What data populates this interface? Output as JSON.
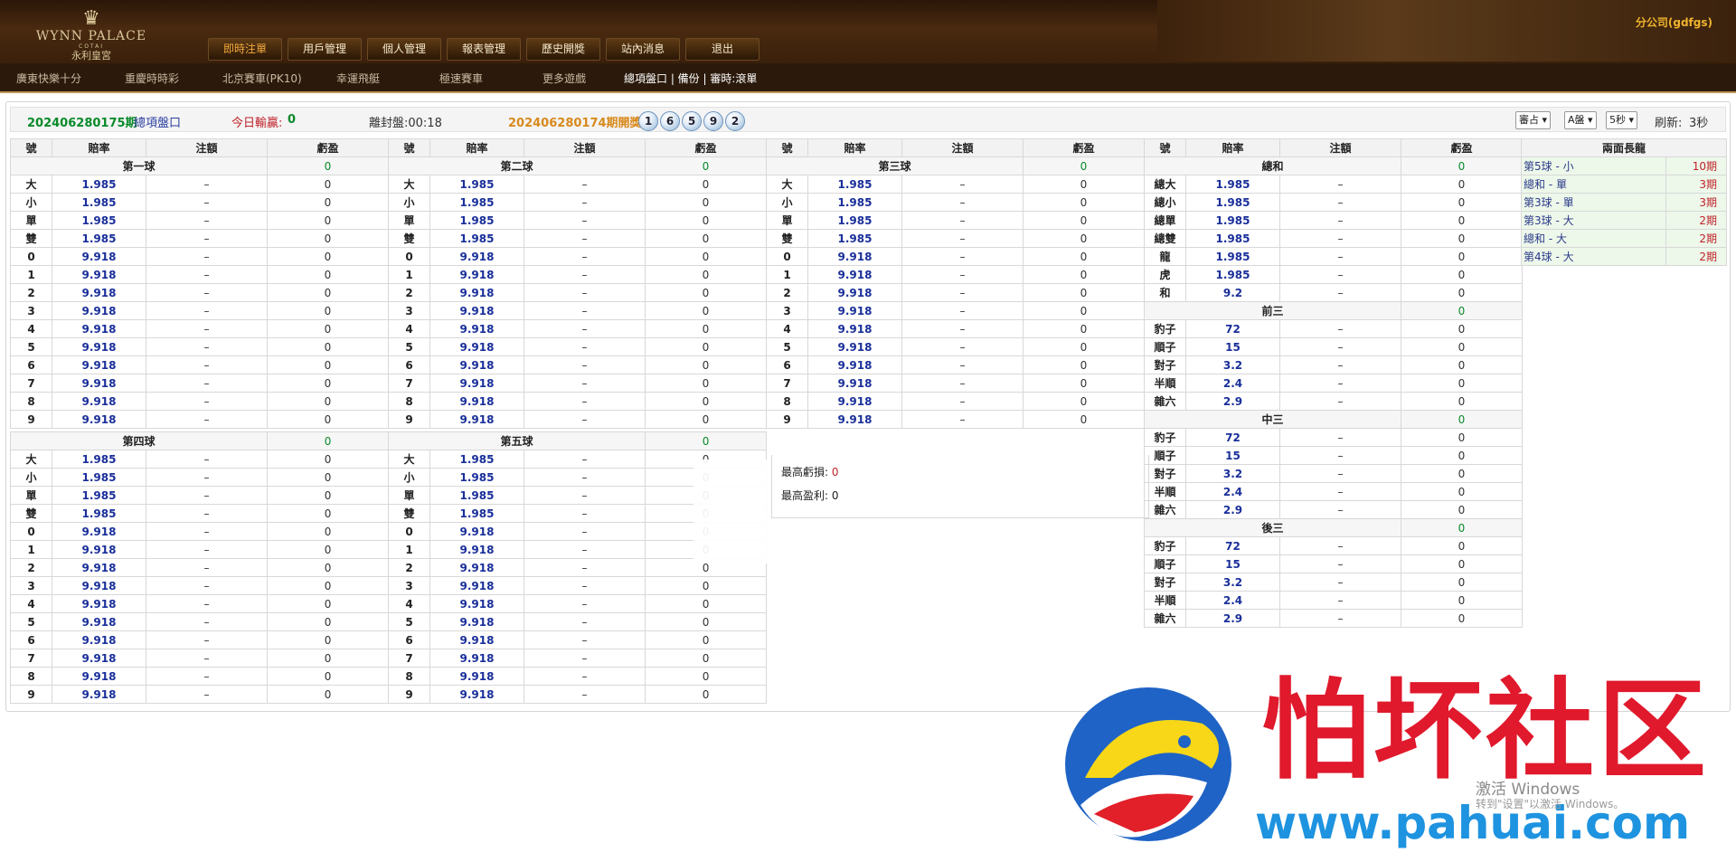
{
  "header": {
    "logo": {
      "name": "WYNN PALACE",
      "sub": "COTAI",
      "cn": "永利皇宮"
    },
    "company": "分公司(gdfgs)",
    "nav": [
      {
        "label": "即時注單",
        "active": true
      },
      {
        "label": "用戶管理"
      },
      {
        "label": "個人管理"
      },
      {
        "label": "報表管理"
      },
      {
        "label": "歷史開獎"
      },
      {
        "label": "站內消息"
      },
      {
        "label": "退出"
      }
    ]
  },
  "subnav": {
    "games": [
      "廣東快樂十分",
      "重慶時時彩",
      "北京賽車(PK10)",
      "幸運飛艇",
      "極速賽車",
      "更多遊戲"
    ],
    "right": "總項盤口 | 備份 | 審時:滾單"
  },
  "infobar": {
    "period": "20240628017​5期",
    "market": "總項盤口",
    "today_label": "今日輸贏:",
    "today_value": "0",
    "close_label": "離封盤:00:18",
    "last_label": "20240628017​4期開獎:",
    "balls": [
      "1",
      "6",
      "5",
      "9",
      "2"
    ],
    "selects": [
      "審占",
      "A盤",
      "5秒"
    ],
    "refresh_label": "刷新:",
    "refresh_value": "3秒"
  },
  "columns": {
    "no": "號",
    "odds": "賠率",
    "amount": "注額",
    "pl": "虧盈"
  },
  "balls_tables": [
    {
      "title": "第一球",
      "pl": "0",
      "rows": [
        [
          "大",
          "1.985",
          "–",
          "0"
        ],
        [
          "小",
          "1.985",
          "–",
          "0"
        ],
        [
          "單",
          "1.985",
          "–",
          "0"
        ],
        [
          "雙",
          "1.985",
          "–",
          "0"
        ],
        [
          "0",
          "9.918",
          "–",
          "0"
        ],
        [
          "1",
          "9.918",
          "–",
          "0"
        ],
        [
          "2",
          "9.918",
          "–",
          "0"
        ],
        [
          "3",
          "9.918",
          "–",
          "0"
        ],
        [
          "4",
          "9.918",
          "–",
          "0"
        ],
        [
          "5",
          "9.918",
          "–",
          "0"
        ],
        [
          "6",
          "9.918",
          "–",
          "0"
        ],
        [
          "7",
          "9.918",
          "–",
          "0"
        ],
        [
          "8",
          "9.918",
          "–",
          "0"
        ],
        [
          "9",
          "9.918",
          "–",
          "0"
        ]
      ]
    },
    {
      "title": "第二球",
      "pl": "0",
      "rows": [
        [
          "大",
          "1.985",
          "–",
          "0"
        ],
        [
          "小",
          "1.985",
          "–",
          "0"
        ],
        [
          "單",
          "1.985",
          "–",
          "0"
        ],
        [
          "雙",
          "1.985",
          "–",
          "0"
        ],
        [
          "0",
          "9.918",
          "–",
          "0"
        ],
        [
          "1",
          "9.918",
          "–",
          "0"
        ],
        [
          "2",
          "9.918",
          "–",
          "0"
        ],
        [
          "3",
          "9.918",
          "–",
          "0"
        ],
        [
          "4",
          "9.918",
          "–",
          "0"
        ],
        [
          "5",
          "9.918",
          "–",
          "0"
        ],
        [
          "6",
          "9.918",
          "–",
          "0"
        ],
        [
          "7",
          "9.918",
          "–",
          "0"
        ],
        [
          "8",
          "9.918",
          "–",
          "0"
        ],
        [
          "9",
          "9.918",
          "–",
          "0"
        ]
      ]
    },
    {
      "title": "第三球",
      "pl": "0",
      "rows": [
        [
          "大",
          "1.985",
          "–",
          "0"
        ],
        [
          "小",
          "1.985",
          "–",
          "0"
        ],
        [
          "單",
          "1.985",
          "–",
          "0"
        ],
        [
          "雙",
          "1.985",
          "–",
          "0"
        ],
        [
          "0",
          "9.918",
          "–",
          "0"
        ],
        [
          "1",
          "9.918",
          "–",
          "0"
        ],
        [
          "2",
          "9.918",
          "–",
          "0"
        ],
        [
          "3",
          "9.918",
          "–",
          "0"
        ],
        [
          "4",
          "9.918",
          "–",
          "0"
        ],
        [
          "5",
          "9.918",
          "–",
          "0"
        ],
        [
          "6",
          "9.918",
          "–",
          "0"
        ],
        [
          "7",
          "9.918",
          "–",
          "0"
        ],
        [
          "8",
          "9.918",
          "–",
          "0"
        ],
        [
          "9",
          "9.918",
          "–",
          "0"
        ]
      ]
    },
    {
      "title": "第四球",
      "pl": "0",
      "rows": [
        [
          "大",
          "1.985",
          "–",
          "0"
        ],
        [
          "小",
          "1.985",
          "–",
          "0"
        ],
        [
          "單",
          "1.985",
          "–",
          "0"
        ],
        [
          "雙",
          "1.985",
          "–",
          "0"
        ],
        [
          "0",
          "9.918",
          "–",
          "0"
        ],
        [
          "1",
          "9.918",
          "–",
          "0"
        ],
        [
          "2",
          "9.918",
          "–",
          "0"
        ],
        [
          "3",
          "9.918",
          "–",
          "0"
        ],
        [
          "4",
          "9.918",
          "–",
          "0"
        ],
        [
          "5",
          "9.918",
          "–",
          "0"
        ],
        [
          "6",
          "9.918",
          "–",
          "0"
        ],
        [
          "7",
          "9.918",
          "–",
          "0"
        ],
        [
          "8",
          "9.918",
          "–",
          "0"
        ],
        [
          "9",
          "9.918",
          "–",
          "0"
        ]
      ]
    },
    {
      "title": "第五球",
      "pl": "0",
      "rows": [
        [
          "大",
          "1.985",
          "–",
          "0"
        ],
        [
          "小",
          "1.985",
          "–",
          "0"
        ],
        [
          "單",
          "1.985",
          "–",
          "0"
        ],
        [
          "雙",
          "1.985",
          "–",
          "0"
        ],
        [
          "0",
          "9.918",
          "–",
          "0"
        ],
        [
          "1",
          "9.918",
          "–",
          "0"
        ],
        [
          "2",
          "9.918",
          "–",
          "0"
        ],
        [
          "3",
          "9.918",
          "–",
          "0"
        ],
        [
          "4",
          "9.918",
          "–",
          "0"
        ],
        [
          "5",
          "9.918",
          "–",
          "0"
        ],
        [
          "6",
          "9.918",
          "–",
          "0"
        ],
        [
          "7",
          "9.918",
          "–",
          "0"
        ],
        [
          "8",
          "9.918",
          "–",
          "0"
        ],
        [
          "9",
          "9.918",
          "–",
          "0"
        ]
      ]
    }
  ],
  "sum_table": {
    "sections": [
      {
        "title": "總和",
        "pl": "0",
        "rows": [
          [
            "總大",
            "1.985",
            "–",
            "0"
          ],
          [
            "總小",
            "1.985",
            "–",
            "0"
          ],
          [
            "總單",
            "1.985",
            "–",
            "0"
          ],
          [
            "總雙",
            "1.985",
            "–",
            "0"
          ],
          [
            "龍",
            "1.985",
            "–",
            "0"
          ],
          [
            "虎",
            "1.985",
            "–",
            "0"
          ],
          [
            "和",
            "9.2",
            "–",
            "0"
          ]
        ]
      },
      {
        "title": "前三",
        "pl": "0",
        "rows": [
          [
            "豹子",
            "72",
            "–",
            "0"
          ],
          [
            "順子",
            "15",
            "–",
            "0"
          ],
          [
            "對子",
            "3.2",
            "–",
            "0"
          ],
          [
            "半順",
            "2.4",
            "–",
            "0"
          ],
          [
            "雜六",
            "2.9",
            "–",
            "0"
          ]
        ]
      },
      {
        "title": "中三",
        "pl": "0",
        "rows": [
          [
            "豹子",
            "72",
            "–",
            "0"
          ],
          [
            "順子",
            "15",
            "–",
            "0"
          ],
          [
            "對子",
            "3.2",
            "–",
            "0"
          ],
          [
            "半順",
            "2.4",
            "–",
            "0"
          ],
          [
            "雜六",
            "2.9",
            "–",
            "0"
          ]
        ]
      },
      {
        "title": "後三",
        "pl": "0",
        "rows": [
          [
            "豹子",
            "72",
            "–",
            "0"
          ],
          [
            "順子",
            "15",
            "–",
            "0"
          ],
          [
            "對子",
            "3.2",
            "–",
            "0"
          ],
          [
            "半順",
            "2.4",
            "–",
            "0"
          ],
          [
            "雜六",
            "2.9",
            "–",
            "0"
          ]
        ]
      }
    ]
  },
  "stats": {
    "max_loss_label": "最高虧損:",
    "max_loss": "0",
    "max_profit_label": "最高盈利:",
    "max_profit": "0"
  },
  "long_dragon": {
    "title": "兩面長龍",
    "rows": [
      [
        "第5球 -  小",
        "10期"
      ],
      [
        "總和  -  單",
        "3期"
      ],
      [
        "第3球 -  單",
        "3期"
      ],
      [
        "第3球 -  大",
        "2期"
      ],
      [
        "總和  -  大",
        "2期"
      ],
      [
        "第4球 -  大",
        "2期"
      ]
    ]
  },
  "watermark": {
    "text": "怕坏社区",
    "url": "www.pahuai.com",
    "win1": "激活 Windows",
    "win2": "转到\"设置\"以激活 Windows。"
  },
  "colors": {
    "header": "#3a200b",
    "accent": "#f2a93a",
    "green": "#0a8a2a",
    "odds": "#1a2f9a",
    "red": "#c0222a"
  }
}
